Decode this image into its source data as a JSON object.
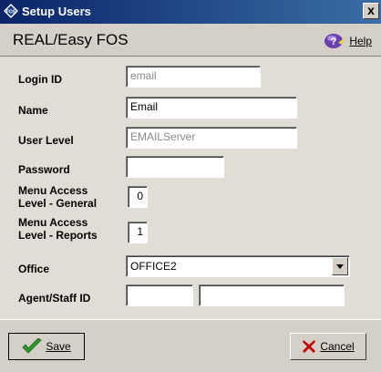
{
  "window": {
    "title": "Setup Users",
    "close_glyph": "x"
  },
  "header": {
    "title": "REAL/Easy FOS",
    "help_label": "Help"
  },
  "form": {
    "login_id": {
      "label": "Login ID",
      "value": "email"
    },
    "name": {
      "label": "Name",
      "value": "Email"
    },
    "user_level": {
      "label": "User Level",
      "value": "EMAILServer"
    },
    "password": {
      "label": "Password",
      "value": ""
    },
    "menu_access_general": {
      "label_line1": "Menu Access",
      "label_line2": "Level - General",
      "value": "0"
    },
    "menu_access_reports": {
      "label_line1": "Menu Access",
      "label_line2": "Level - Reports",
      "value": "1"
    },
    "office": {
      "label": "Office",
      "value": "OFFICE2"
    },
    "agent_staff_id": {
      "label": "Agent/Staff ID",
      "value1": "",
      "value2": ""
    }
  },
  "buttons": {
    "save_label": "Save",
    "cancel_label": "Cancel"
  },
  "icons": {
    "app": "fos-app-icon",
    "help": "help-icon",
    "save": "checkmark-icon",
    "cancel": "x-icon"
  },
  "colors": {
    "titlebar": "#0a246a",
    "dialog": "#d4d0c8",
    "save_check": "#2e9b2e",
    "cancel_x": "#c00000"
  }
}
